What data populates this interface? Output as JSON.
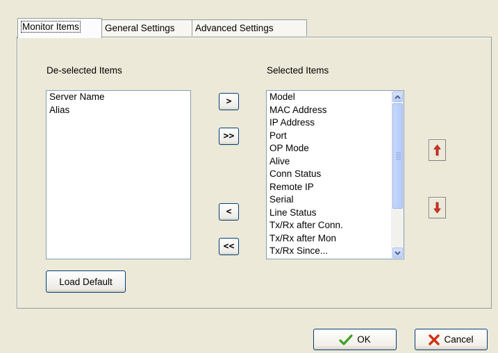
{
  "tabs": [
    {
      "label": "Monitor Items",
      "active": true
    },
    {
      "label": "General Settings",
      "active": false
    },
    {
      "label": "Advanced Settings",
      "active": false
    }
  ],
  "deselected": {
    "label": "De-selected Items",
    "items": [
      "Server Name",
      "Alias"
    ]
  },
  "selected": {
    "label": "Selected Items",
    "items": [
      "Model",
      "MAC Address",
      "IP Address",
      "Port",
      "OP Mode",
      "Alive",
      "Conn Status",
      "Remote IP",
      "Serial",
      "Line Status",
      "Tx/Rx after Conn.",
      "Tx/Rx after Mon",
      "Tx/Rx Since..."
    ]
  },
  "transfer": {
    "add_label": ">",
    "add_all_label": ">>",
    "remove_label": "<",
    "remove_all_label": "<<"
  },
  "order": {
    "up_icon": "red-up-arrow-icon",
    "down_icon": "red-down-arrow-icon"
  },
  "load_default_label": "Load Default",
  "dialog": {
    "ok_label": "OK",
    "cancel_label": "Cancel"
  },
  "colors": {
    "window_bg": "#ece9d8",
    "list_border": "#7f9db9",
    "arrow_red": "#e03020",
    "ok_green": "#3aa020",
    "cancel_red": "#d03010"
  }
}
